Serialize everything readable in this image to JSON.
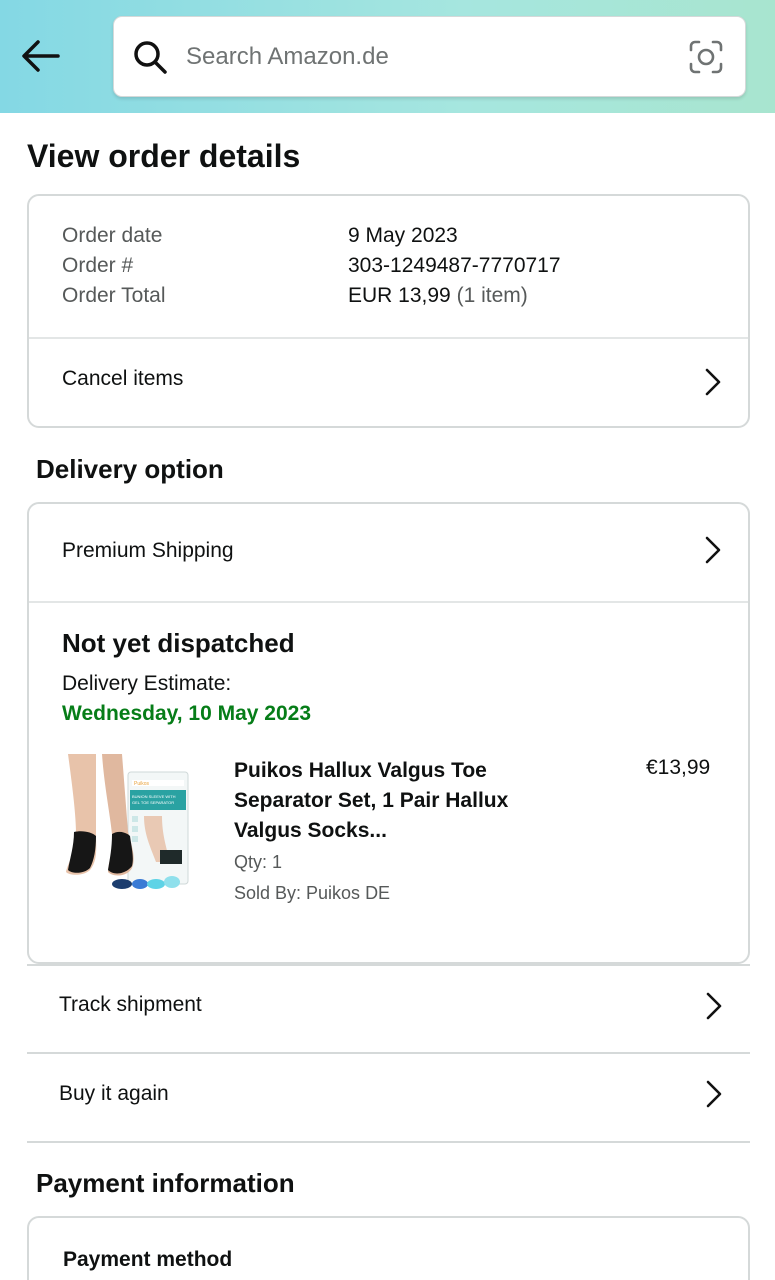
{
  "header": {
    "back_icon": "arrow-left-icon",
    "search_placeholder": "Search Amazon.de",
    "search_icon": "search-icon",
    "camera_icon": "camera-scan-icon"
  },
  "page_title": "View order details",
  "order_summary": {
    "rows": [
      {
        "label": "Order date",
        "value": "9 May 2023"
      },
      {
        "label": "Order #",
        "value": "303-1249487-7770717"
      },
      {
        "label": "Order Total",
        "value": "EUR 13,99",
        "extra": "(1 item)"
      }
    ],
    "cancel_label": "Cancel items"
  },
  "delivery": {
    "section_title": "Delivery option",
    "shipping_label": "Premium Shipping",
    "status": "Not yet dispatched",
    "estimate_label": "Delivery Estimate:",
    "estimate_date": "Wednesday, 10 May 2023",
    "estimate_color": "#067d18",
    "product": {
      "title": "Puikos Hallux Valgus Toe Separator Set, 1 Pair Hallux Valgus Socks...",
      "price": "€13,99",
      "qty": "Qty: 1",
      "sold_by": "Sold By: Puikos DE",
      "image_box_text": "BUNION SLEEVE WITH GEL TOE SEPARATOR",
      "image_brand": "Puikos"
    }
  },
  "actions": [
    {
      "label": "Track shipment"
    },
    {
      "label": "Buy it again"
    }
  ],
  "payment": {
    "section_title": "Payment information",
    "method_label": "Payment method"
  }
}
